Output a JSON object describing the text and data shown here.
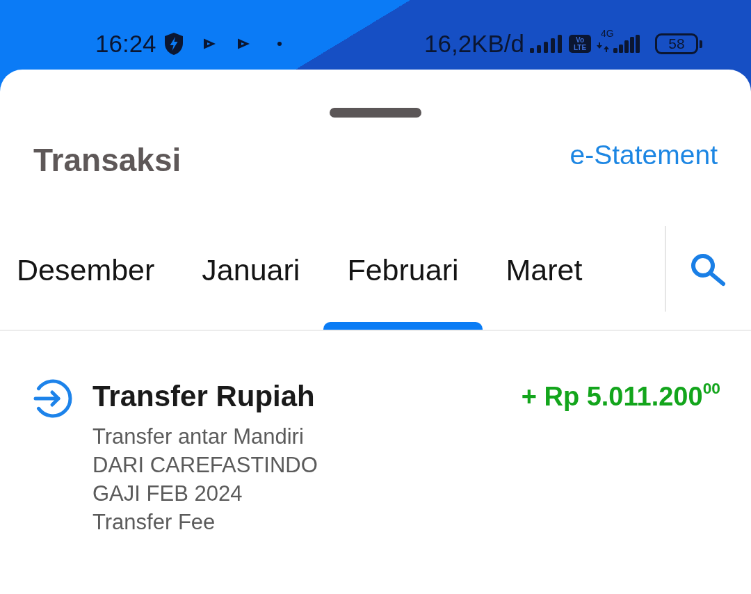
{
  "status_bar": {
    "time": "16:24",
    "data_rate": "16,2KB/d",
    "volte": "Vo LTE",
    "network_type": "4G",
    "battery": "58"
  },
  "header": {
    "title": "Transaksi",
    "link": "e-Statement"
  },
  "tabs": [
    {
      "label": "Desember",
      "selected": false
    },
    {
      "label": "Januari",
      "selected": false
    },
    {
      "label": "Februari",
      "selected": true
    },
    {
      "label": "Maret",
      "selected": false
    }
  ],
  "transactions": [
    {
      "kind": "incoming",
      "title": "Transfer Rupiah",
      "details": [
        "Transfer antar Mandiri",
        "DARI CAREFASTINDO",
        "GAJI FEB 2024",
        "Transfer Fee"
      ],
      "amount": "+ Rp 5.011.200$^{00}$"
    }
  ]
}
